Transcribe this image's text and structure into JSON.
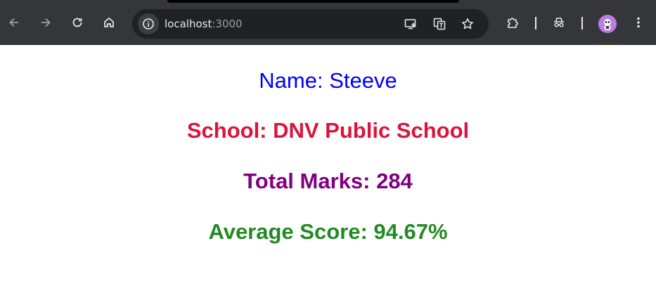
{
  "browser": {
    "url_host": "localhost",
    "url_port": ":3000",
    "icons": {
      "back": "arrow-left-icon",
      "forward": "arrow-right-icon",
      "reload": "reload-icon",
      "home": "home-icon",
      "site_info": "info-icon",
      "install": "install-app-icon",
      "translate": "translate-icon",
      "bookmark": "star-icon",
      "extensions": "puzzle-icon",
      "incognito": "incognito-icon",
      "profile": "avatar-icon",
      "menu": "kebab-menu-icon"
    }
  },
  "page": {
    "name_text": "Name: Steeve",
    "school_text": "School: DNV Public School",
    "marks_text": "Total Marks: 284",
    "average_text": "Average Score: 94.67%",
    "colors": {
      "name": "#0000ff",
      "school": "#dc143c",
      "marks": "#800080",
      "average": "#228b22"
    }
  }
}
